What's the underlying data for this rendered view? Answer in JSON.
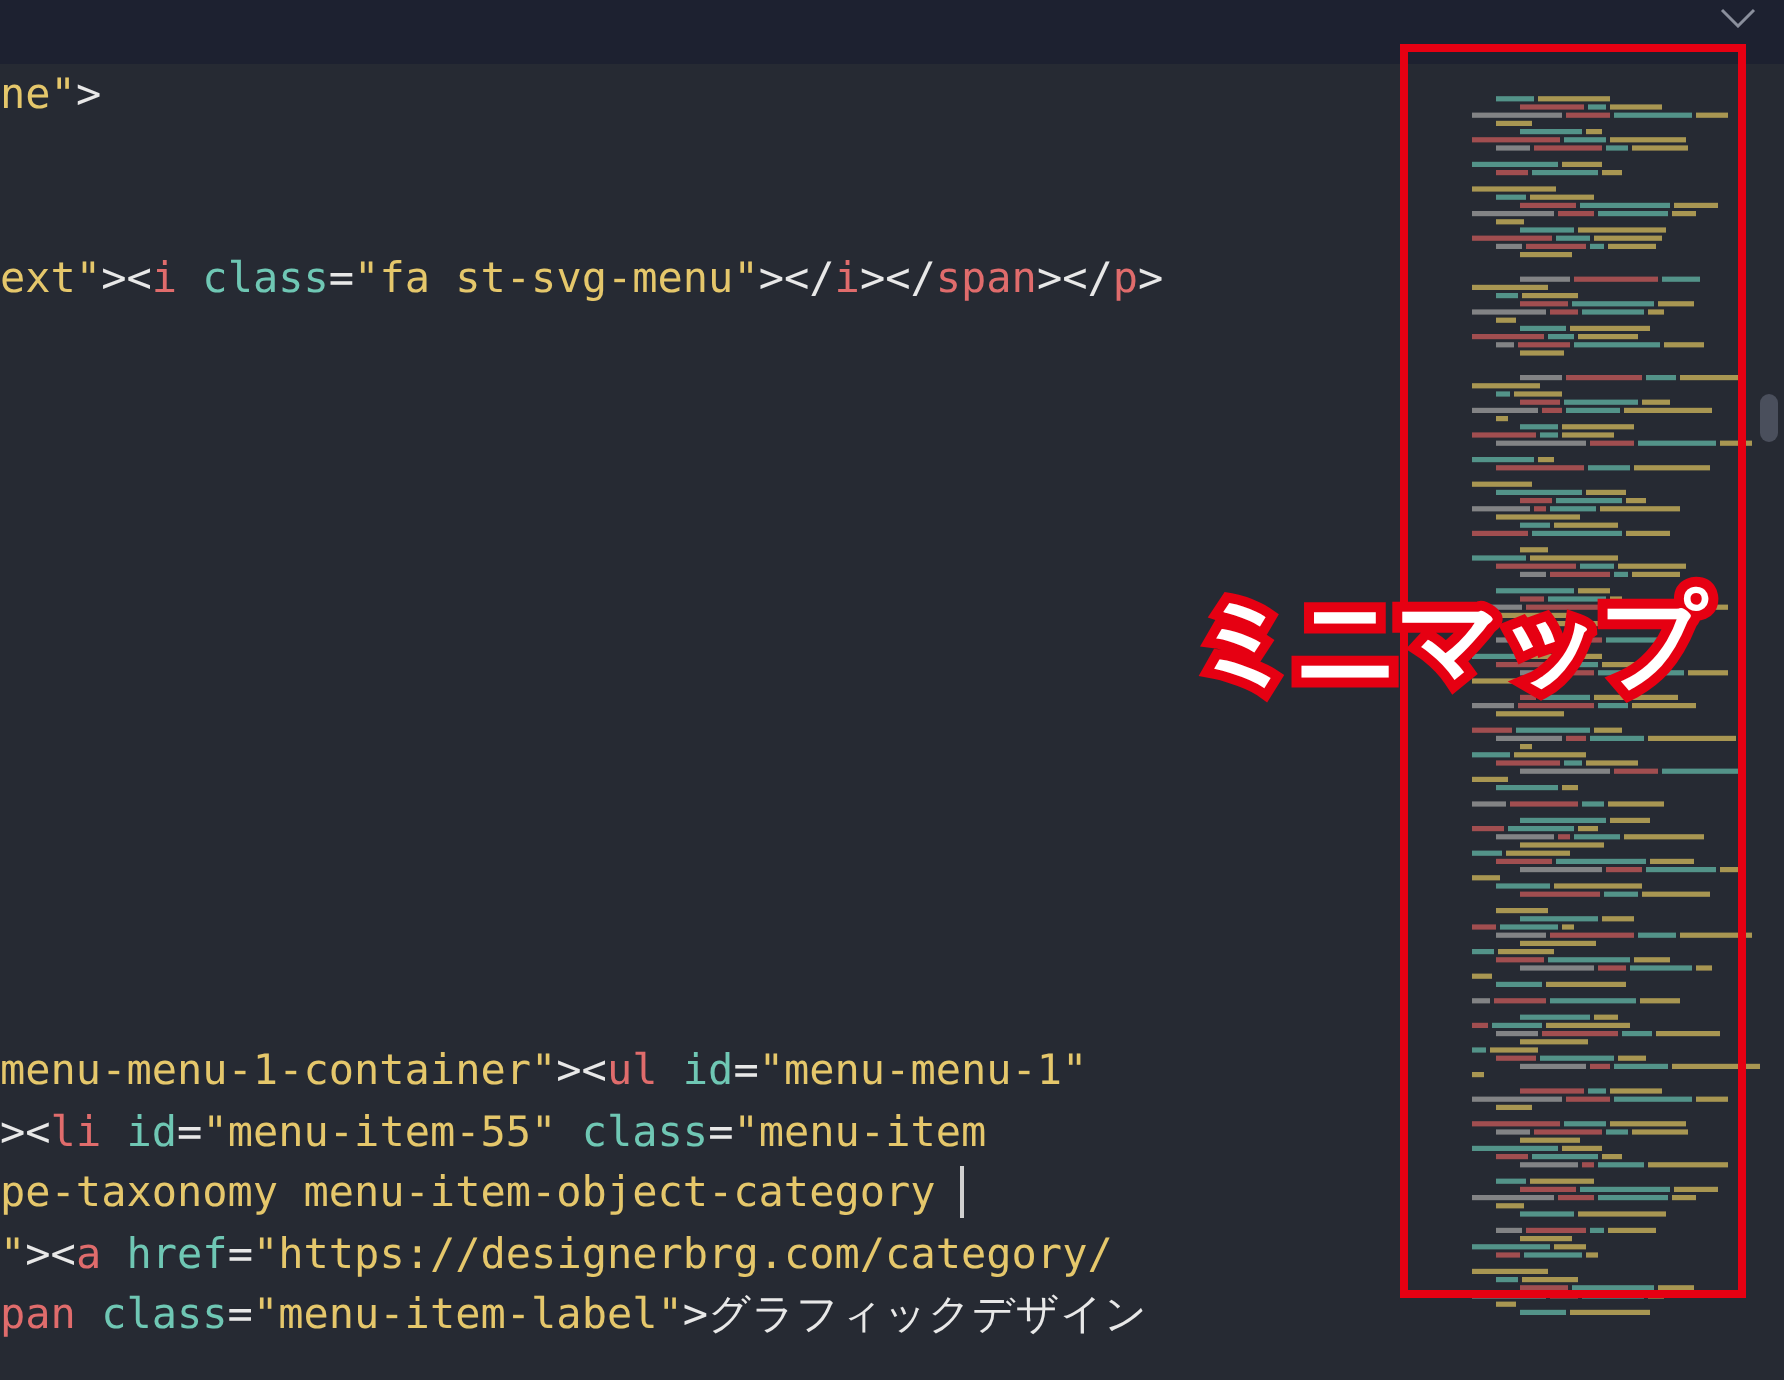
{
  "editor": {
    "lines": [
      {
        "kind": "code",
        "tokens": [
          {
            "kind": "string",
            "text": "ne\""
          },
          {
            "kind": "punct",
            "text": ">"
          }
        ]
      },
      {
        "kind": "blank"
      },
      {
        "kind": "blank"
      },
      {
        "kind": "code",
        "tokens": [
          {
            "kind": "string",
            "text": "ext\""
          },
          {
            "kind": "punct",
            "text": "><"
          },
          {
            "kind": "tag",
            "text": "i"
          },
          {
            "kind": "attr",
            "text": "class"
          },
          {
            "kind": "punct",
            "text": "="
          },
          {
            "kind": "string",
            "text": "\"fa st-svg-menu\""
          },
          {
            "kind": "punct",
            "text": "></"
          },
          {
            "kind": "tag",
            "text": "i"
          },
          {
            "kind": "punct",
            "text": "></"
          },
          {
            "kind": "tag",
            "text": "span"
          },
          {
            "kind": "punct",
            "text": "></"
          },
          {
            "kind": "tag",
            "text": "p"
          },
          {
            "kind": "punct",
            "text": ">"
          }
        ]
      },
      {
        "kind": "blank"
      },
      {
        "kind": "blank"
      },
      {
        "kind": "blank"
      },
      {
        "kind": "blank"
      },
      {
        "kind": "blank"
      },
      {
        "kind": "blank"
      },
      {
        "kind": "blank"
      },
      {
        "kind": "blank"
      },
      {
        "kind": "blank"
      },
      {
        "kind": "blank"
      },
      {
        "kind": "blank"
      },
      {
        "kind": "blank"
      },
      {
        "kind": "code",
        "tokens": [
          {
            "kind": "string",
            "text": "menu-menu-1-container\""
          },
          {
            "kind": "punct",
            "text": "><"
          },
          {
            "kind": "tag",
            "text": "ul"
          },
          {
            "kind": "attr",
            "text": "id"
          },
          {
            "kind": "punct",
            "text": "="
          },
          {
            "kind": "string",
            "text": "\"menu-menu-1\""
          }
        ]
      },
      {
        "kind": "code",
        "tokens": [
          {
            "kind": "punct",
            "text": "><"
          },
          {
            "kind": "tag",
            "text": "li"
          },
          {
            "kind": "attr",
            "text": "id"
          },
          {
            "kind": "punct",
            "text": "="
          },
          {
            "kind": "string",
            "text": "\"menu-item-55\""
          },
          {
            "kind": "attr",
            "text": "class"
          },
          {
            "kind": "punct",
            "text": "="
          },
          {
            "kind": "string",
            "text": "\"menu-item"
          }
        ]
      },
      {
        "kind": "code",
        "cursor": true,
        "tokens": [
          {
            "kind": "string",
            "text": "pe-taxonomy menu-item-object-category"
          }
        ]
      },
      {
        "kind": "code",
        "tokens": [
          {
            "kind": "string",
            "text": "\""
          },
          {
            "kind": "punct",
            "text": "><"
          },
          {
            "kind": "tag",
            "text": "a"
          },
          {
            "kind": "attr",
            "text": "href"
          },
          {
            "kind": "punct",
            "text": "="
          },
          {
            "kind": "string",
            "text": "\"https://designerbrg.com/category/"
          }
        ]
      },
      {
        "kind": "code",
        "tokens": [
          {
            "kind": "tag",
            "text": "pan"
          },
          {
            "kind": "attr",
            "text": "class"
          },
          {
            "kind": "punct",
            "text": "="
          },
          {
            "kind": "string",
            "text": "\"menu-item-label\""
          },
          {
            "kind": "punct",
            "text": ">"
          },
          {
            "kind": "punct",
            "text": "グラフィックデザイン"
          }
        ]
      }
    ]
  },
  "minimap": {
    "callout": "ミニマップ"
  }
}
